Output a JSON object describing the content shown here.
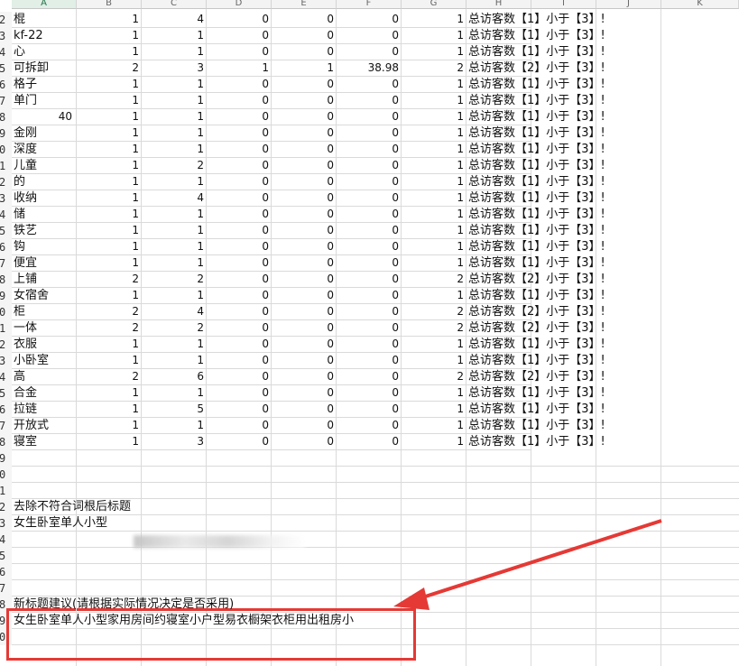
{
  "columns": [
    "A",
    "B",
    "C",
    "D",
    "E",
    "F",
    "G",
    "H",
    "I",
    "J",
    "K"
  ],
  "rows": [
    {
      "n": "2",
      "a": "棍",
      "b": "1",
      "c": "4",
      "d": "0",
      "e": "0",
      "f": "0",
      "g": "1",
      "h": "总访客数【1】小于【3】!"
    },
    {
      "n": "3",
      "a": "kf-22",
      "b": "1",
      "c": "1",
      "d": "0",
      "e": "0",
      "f": "0",
      "g": "1",
      "h": "总访客数【1】小于【3】!"
    },
    {
      "n": "4",
      "a": "心",
      "b": "1",
      "c": "1",
      "d": "0",
      "e": "0",
      "f": "0",
      "g": "1",
      "h": "总访客数【1】小于【3】!"
    },
    {
      "n": "5",
      "a": "可拆卸",
      "b": "2",
      "c": "3",
      "d": "1",
      "e": "1",
      "f": "38.98",
      "g": "2",
      "h": "总访客数【2】小于【3】!"
    },
    {
      "n": "6",
      "a": "格子",
      "b": "1",
      "c": "1",
      "d": "0",
      "e": "0",
      "f": "0",
      "g": "1",
      "h": "总访客数【1】小于【3】!"
    },
    {
      "n": "7",
      "a": "单门",
      "b": "1",
      "c": "1",
      "d": "0",
      "e": "0",
      "f": "0",
      "g": "1",
      "h": "总访客数【1】小于【3】!"
    },
    {
      "n": "8",
      "a": "40",
      "b": "1",
      "c": "1",
      "d": "0",
      "e": "0",
      "f": "0",
      "g": "1",
      "h": "总访客数【1】小于【3】!"
    },
    {
      "n": "9",
      "a": "金刚",
      "b": "1",
      "c": "1",
      "d": "0",
      "e": "0",
      "f": "0",
      "g": "1",
      "h": "总访客数【1】小于【3】!"
    },
    {
      "n": "0",
      "a": "深度",
      "b": "1",
      "c": "1",
      "d": "0",
      "e": "0",
      "f": "0",
      "g": "1",
      "h": "总访客数【1】小于【3】!"
    },
    {
      "n": "1",
      "a": "儿童",
      "b": "1",
      "c": "2",
      "d": "0",
      "e": "0",
      "f": "0",
      "g": "1",
      "h": "总访客数【1】小于【3】!"
    },
    {
      "n": "2",
      "a": "的",
      "b": "1",
      "c": "1",
      "d": "0",
      "e": "0",
      "f": "0",
      "g": "1",
      "h": "总访客数【1】小于【3】!"
    },
    {
      "n": "3",
      "a": "收纳",
      "b": "1",
      "c": "4",
      "d": "0",
      "e": "0",
      "f": "0",
      "g": "1",
      "h": "总访客数【1】小于【3】!"
    },
    {
      "n": "4",
      "a": "储",
      "b": "1",
      "c": "1",
      "d": "0",
      "e": "0",
      "f": "0",
      "g": "1",
      "h": "总访客数【1】小于【3】!"
    },
    {
      "n": "5",
      "a": "铁艺",
      "b": "1",
      "c": "1",
      "d": "0",
      "e": "0",
      "f": "0",
      "g": "1",
      "h": "总访客数【1】小于【3】!"
    },
    {
      "n": "6",
      "a": "钩",
      "b": "1",
      "c": "1",
      "d": "0",
      "e": "0",
      "f": "0",
      "g": "1",
      "h": "总访客数【1】小于【3】!"
    },
    {
      "n": "7",
      "a": "便宜",
      "b": "1",
      "c": "1",
      "d": "0",
      "e": "0",
      "f": "0",
      "g": "1",
      "h": "总访客数【1】小于【3】!"
    },
    {
      "n": "8",
      "a": "上铺",
      "b": "2",
      "c": "2",
      "d": "0",
      "e": "0",
      "f": "0",
      "g": "2",
      "h": "总访客数【2】小于【3】!"
    },
    {
      "n": "9",
      "a": "女宿舍",
      "b": "1",
      "c": "1",
      "d": "0",
      "e": "0",
      "f": "0",
      "g": "1",
      "h": "总访客数【1】小于【3】!"
    },
    {
      "n": "0",
      "a": "柜",
      "b": "2",
      "c": "4",
      "d": "0",
      "e": "0",
      "f": "0",
      "g": "2",
      "h": "总访客数【2】小于【3】!"
    },
    {
      "n": "1",
      "a": "一体",
      "b": "2",
      "c": "2",
      "d": "0",
      "e": "0",
      "f": "0",
      "g": "2",
      "h": "总访客数【2】小于【3】!"
    },
    {
      "n": "2",
      "a": "衣服",
      "b": "1",
      "c": "1",
      "d": "0",
      "e": "0",
      "f": "0",
      "g": "1",
      "h": "总访客数【1】小于【3】!"
    },
    {
      "n": "3",
      "a": "小卧室",
      "b": "1",
      "c": "1",
      "d": "0",
      "e": "0",
      "f": "0",
      "g": "1",
      "h": "总访客数【1】小于【3】!"
    },
    {
      "n": "4",
      "a": "高",
      "b": "2",
      "c": "6",
      "d": "0",
      "e": "0",
      "f": "0",
      "g": "2",
      "h": "总访客数【2】小于【3】!"
    },
    {
      "n": "5",
      "a": "合金",
      "b": "1",
      "c": "1",
      "d": "0",
      "e": "0",
      "f": "0",
      "g": "1",
      "h": "总访客数【1】小于【3】!"
    },
    {
      "n": "6",
      "a": "拉链",
      "b": "1",
      "c": "5",
      "d": "0",
      "e": "0",
      "f": "0",
      "g": "1",
      "h": "总访客数【1】小于【3】!"
    },
    {
      "n": "7",
      "a": "开放式",
      "b": "1",
      "c": "1",
      "d": "0",
      "e": "0",
      "f": "0",
      "g": "1",
      "h": "总访客数【1】小于【3】!"
    },
    {
      "n": "8",
      "a": "寝室",
      "b": "1",
      "c": "3",
      "d": "0",
      "e": "0",
      "f": "0",
      "g": "1",
      "h": "总访客数【1】小于【3】!"
    }
  ],
  "trailing_rows": [
    {
      "n": "9",
      "a": ""
    },
    {
      "n": "0",
      "a": ""
    },
    {
      "n": "1",
      "a": ""
    },
    {
      "n": "2",
      "a": "去除不符合词根后标题"
    },
    {
      "n": "3",
      "a": "女生卧室单人小型"
    },
    {
      "n": "4",
      "a": ""
    },
    {
      "n": "5",
      "a": ""
    },
    {
      "n": "6",
      "a": ""
    },
    {
      "n": "7",
      "a": ""
    },
    {
      "n": "8",
      "a": "新标题建议(请根据实际情况决定是否采用)"
    },
    {
      "n": "9",
      "a": "女生卧室单人小型家用房间约寝室小户型易衣橱架衣柜用出租房小"
    },
    {
      "n": "0",
      "a": ""
    }
  ],
  "annotation": {
    "arrow_color": "#e53935",
    "box_color": "#e53935"
  }
}
